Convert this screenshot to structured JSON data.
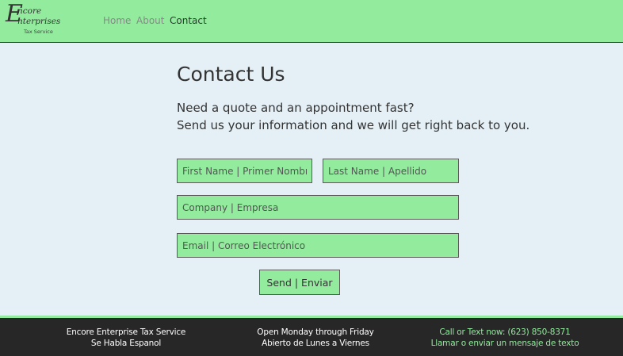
{
  "brand": {
    "initial": "E",
    "line1": "ncore",
    "line2": "nterprises",
    "line3": "Tax Service"
  },
  "nav": {
    "home": "Home",
    "about": "About",
    "contact": "Contact"
  },
  "main": {
    "title": "Contact Us",
    "intro_line1": "Need a quote and an appointment fast?",
    "intro_line2": "Send us your information and we will get right back to you."
  },
  "form": {
    "first_name_placeholder": "First Name | Primer Nombre",
    "last_name_placeholder": "Last Name | Apellido",
    "company_placeholder": "Company | Empresa",
    "email_placeholder": "Email | Correo Electrónico",
    "send_label": "Send | Enviar"
  },
  "footer": {
    "col1_line1": "Encore Enterprise Tax Service",
    "col1_line2": "Se Habla Espanol",
    "col2_line1": "Open Monday through Friday",
    "col2_line2": "Abierto de Lunes a Viernes",
    "col3_line1": "Call or Text now: (623) 850-8371",
    "col3_line2": "Llamar o enviar un mensaje de texto"
  },
  "colors": {
    "accent_green": "#93eb9e",
    "page_background": "#e4f0f6",
    "footer_background": "#272727"
  }
}
